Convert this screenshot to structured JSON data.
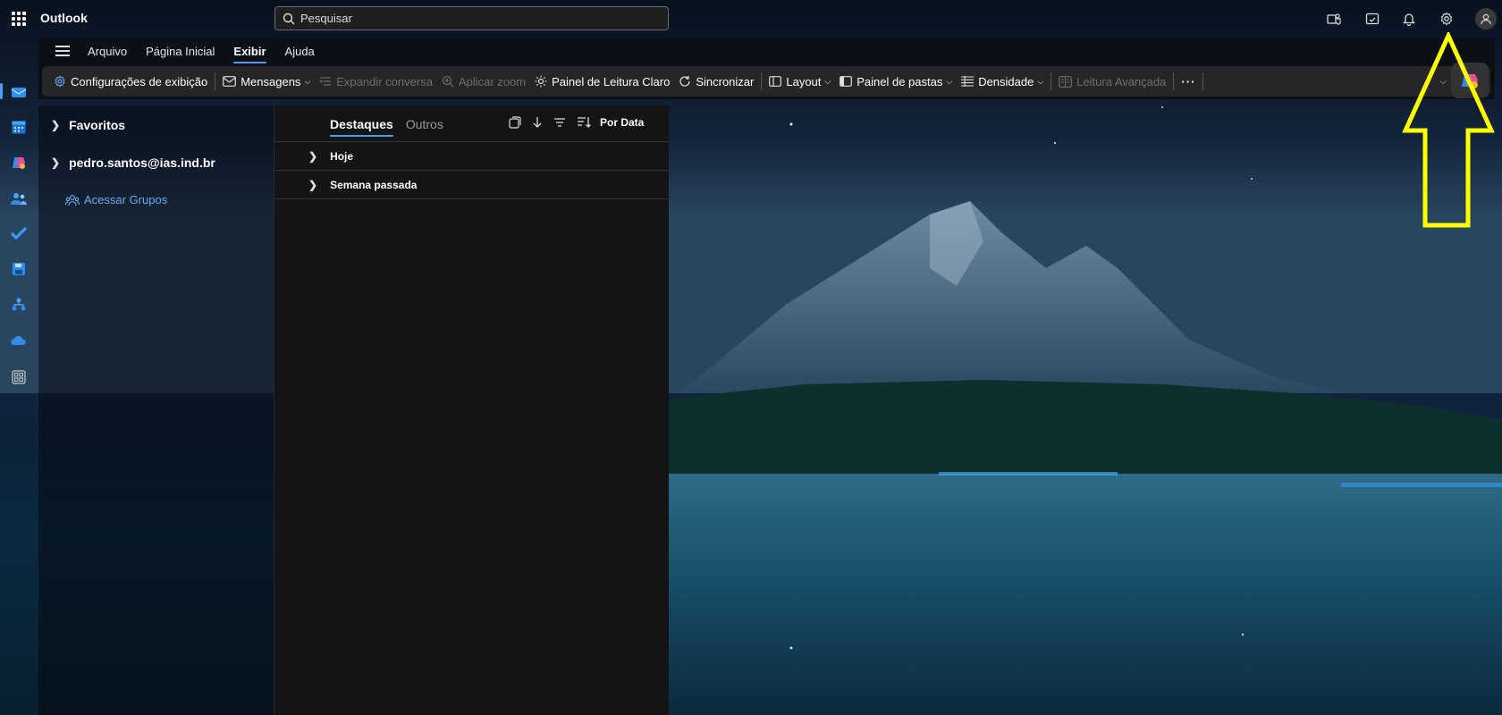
{
  "app": {
    "title": "Outlook"
  },
  "search": {
    "placeholder": "Pesquisar"
  },
  "menu": {
    "items": [
      {
        "label": "Arquivo"
      },
      {
        "label": "Página Inicial"
      },
      {
        "label": "Exibir",
        "active": true
      },
      {
        "label": "Ajuda"
      }
    ]
  },
  "toolbar": {
    "display_settings": "Configurações de exibição",
    "messages": "Mensagens",
    "expand_conversation": "Expandir conversa",
    "apply_zoom": "Aplicar zoom",
    "light_reading_pane": "Painel de Leitura Claro",
    "sync": "Sincronizar",
    "layout": "Layout",
    "folder_pane": "Painel de pastas",
    "density": "Densidade",
    "immersive_reader": "Leitura Avançada",
    "more": "···"
  },
  "folders": {
    "favorites": "Favoritos",
    "account": "pedro.santos@ias.ind.br",
    "groups_link": "Acessar Grupos"
  },
  "message_list": {
    "tabs": [
      "Destaques",
      "Outros"
    ],
    "sort_label": "Por Data",
    "groups": [
      "Hoje",
      "Semana passada"
    ]
  },
  "colors": {
    "accent": "#4f9cf0",
    "annotation": "#ffff00"
  }
}
